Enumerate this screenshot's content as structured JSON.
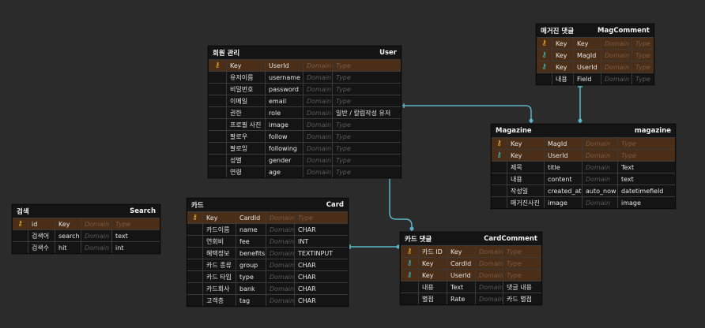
{
  "colors": {
    "background": "#2b2b2b",
    "key_row": "#4a2e17",
    "link": "#5ab4c5",
    "pk_icon": "#f0b429",
    "fk_icon": "#3fc1c9"
  },
  "tables": {
    "user": {
      "title": "회원 관리",
      "name": "User",
      "rows": [
        {
          "icon": "pk",
          "c1": "Key",
          "c2": "UserId",
          "c3": "Domain",
          "c4": "Type"
        },
        {
          "icon": "",
          "c1": "유저이름",
          "c2": "username",
          "c3": "Domain",
          "c4": "Type"
        },
        {
          "icon": "",
          "c1": "비밀번호",
          "c2": "password",
          "c3": "Domain",
          "c4": "Type"
        },
        {
          "icon": "",
          "c1": "이메일",
          "c2": "email",
          "c3": "Domain",
          "c4": "Type"
        },
        {
          "icon": "",
          "c1": "권한",
          "c2": "role",
          "c3": "Domain",
          "c4": "일반 / 칼럼작성 유저"
        },
        {
          "icon": "",
          "c1": "프로필 사진",
          "c2": "image",
          "c3": "Domain",
          "c4": "Type"
        },
        {
          "icon": "",
          "c1": "팔로우",
          "c2": "follow",
          "c3": "Domain",
          "c4": "Type"
        },
        {
          "icon": "",
          "c1": "팔로잉",
          "c2": "following",
          "c3": "Domain",
          "c4": "Type"
        },
        {
          "icon": "",
          "c1": "성별",
          "c2": "gender",
          "c3": "Domain",
          "c4": "Type"
        },
        {
          "icon": "",
          "c1": "연령",
          "c2": "age",
          "c3": "Domain",
          "c4": "Type"
        }
      ]
    },
    "magcomment": {
      "title": "매거진 댓글",
      "name": "MagComment",
      "rows": [
        {
          "icon": "pk",
          "c1": "Key",
          "c2": "Key",
          "c3": "Domain",
          "c4": "Type"
        },
        {
          "icon": "fk",
          "c1": "Key",
          "c2": "MagId",
          "c3": "Domain",
          "c4": "Type"
        },
        {
          "icon": "fk",
          "c1": "Key",
          "c2": "UserId",
          "c3": "Domain",
          "c4": "Type"
        },
        {
          "icon": "",
          "c1": "내용",
          "c2": "Field",
          "c3": "Domain",
          "c4": "Type"
        }
      ]
    },
    "magazine": {
      "title": "Magazine",
      "name": "magazine",
      "rows": [
        {
          "icon": "pk",
          "c1": "Key",
          "c2": "MagId",
          "c3": "Domain",
          "c4": "Type"
        },
        {
          "icon": "fk",
          "c1": "Key",
          "c2": "UserId",
          "c3": "Domain",
          "c4": "Type"
        },
        {
          "icon": "",
          "c1": "제목",
          "c2": "title",
          "c3": "Domain",
          "c4": "Text"
        },
        {
          "icon": "",
          "c1": "내용",
          "c2": "content",
          "c3": "Domain",
          "c4": "text"
        },
        {
          "icon": "",
          "c1": "작성일",
          "c2": "created_at",
          "c3": "auto_now",
          "c4": "datetimefield"
        },
        {
          "icon": "",
          "c1": "매거진사진",
          "c2": "image",
          "c3": "Domain",
          "c4": "image"
        }
      ]
    },
    "search": {
      "title": "검색",
      "name": "Search",
      "rows": [
        {
          "icon": "pk",
          "c1": "id",
          "c2": "Key",
          "c3": "Domain",
          "c4": "Type"
        },
        {
          "icon": "",
          "c1": "검색어",
          "c2": "search",
          "c3": "Domain",
          "c4": "text"
        },
        {
          "icon": "",
          "c1": "검색수",
          "c2": "hit",
          "c3": "Domain",
          "c4": "int"
        }
      ]
    },
    "card": {
      "title": "카드",
      "name": "Card",
      "rows": [
        {
          "icon": "pk",
          "c1": "Key",
          "c2": "CardId",
          "c3": "Domain",
          "c4": "Type"
        },
        {
          "icon": "",
          "c1": "카드이름",
          "c2": "name",
          "c3": "Domain",
          "c4": "CHAR"
        },
        {
          "icon": "",
          "c1": "연회비",
          "c2": "fee",
          "c3": "Domain",
          "c4": "INT"
        },
        {
          "icon": "",
          "c1": "혜택정보",
          "c2": "benefits",
          "c3": "Domain",
          "c4": "TEXTINPUT"
        },
        {
          "icon": "",
          "c1": "카드 종류",
          "c2": "group",
          "c3": "Domain",
          "c4": "CHAR"
        },
        {
          "icon": "",
          "c1": "카드 타입",
          "c2": "type",
          "c3": "Domain",
          "c4": "CHAR"
        },
        {
          "icon": "",
          "c1": "카드회사",
          "c2": "bank",
          "c3": "Domain",
          "c4": "CHAR"
        },
        {
          "icon": "",
          "c1": "고객층",
          "c2": "tag",
          "c3": "Domain",
          "c4": "CHAR"
        }
      ]
    },
    "cardcomment": {
      "title": "카드 댓글",
      "name": "CardComment",
      "rows": [
        {
          "icon": "pk",
          "c1": "카드 ID",
          "c2": "Key",
          "c3": "Domain",
          "c4": "Type"
        },
        {
          "icon": "fk",
          "c1": "Key",
          "c2": "CardId",
          "c3": "Domain",
          "c4": "Type"
        },
        {
          "icon": "fk",
          "c1": "Key",
          "c2": "UserId",
          "c3": "Domain",
          "c4": "Type"
        },
        {
          "icon": "",
          "c1": "내용",
          "c2": "Text",
          "c3": "Domain",
          "c4": "댓글 내용"
        },
        {
          "icon": "",
          "c1": "별점",
          "c2": "Rate",
          "c3": "Domain",
          "c4": "카드 별점"
        }
      ]
    }
  }
}
